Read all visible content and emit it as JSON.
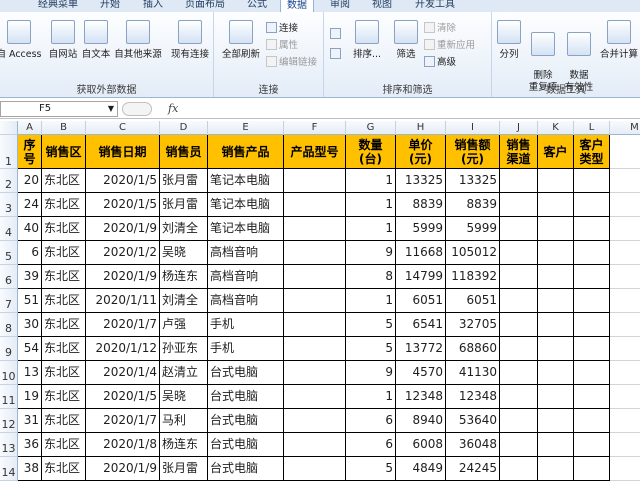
{
  "tabs": [
    {
      "label": "经典菜单",
      "active": false
    },
    {
      "label": "开始",
      "active": false
    },
    {
      "label": "插入",
      "active": false
    },
    {
      "label": "页面布局",
      "active": false
    },
    {
      "label": "公式",
      "active": false
    },
    {
      "label": "数据",
      "active": true
    },
    {
      "label": "审阅",
      "active": false
    },
    {
      "label": "视图",
      "active": false
    },
    {
      "label": "开发工具",
      "active": false
    }
  ],
  "ribbon": {
    "groups": [
      {
        "title": "获取外部数据",
        "buttons": [
          "自 Access",
          "自网站",
          "自文本",
          "自其他来源",
          "现有连接"
        ]
      },
      {
        "title": "连接",
        "buttons": [
          "全部刷新"
        ],
        "small": [
          "连接",
          "属性",
          "编辑链接"
        ]
      },
      {
        "title": "排序和筛选",
        "buttons": [
          "排序...",
          "筛选"
        ],
        "small": [
          "清除",
          "重新应用",
          "高级"
        ]
      },
      {
        "title": "数据工具",
        "buttons": [
          "分列",
          "删除\n重复项",
          "数据\n有效性",
          "合并计算"
        ]
      }
    ]
  },
  "formula_bar": {
    "name_box": "F5",
    "fx": "fx",
    "formula": ""
  },
  "columns": [
    "A",
    "B",
    "C",
    "D",
    "E",
    "F",
    "G",
    "H",
    "I",
    "J",
    "K",
    "L",
    "M"
  ],
  "header_row": [
    "序号",
    "销售区",
    "销售日期",
    "销售员",
    "销售产品",
    "产品型号",
    "数量\n(台)",
    "单价\n(元)",
    "销售额\n(元)",
    "销售\n渠道",
    "客户",
    "客户\n类型"
  ],
  "rows": [
    {
      "n": "2",
      "cells": [
        "20",
        "东北区",
        "2020/1/5",
        "张月雷",
        "笔记本电脑",
        "",
        "1",
        "13325",
        "13325",
        "",
        "",
        ""
      ]
    },
    {
      "n": "3",
      "cells": [
        "24",
        "东北区",
        "2020/1/5",
        "张月雷",
        "笔记本电脑",
        "",
        "1",
        "8839",
        "8839",
        "",
        "",
        ""
      ]
    },
    {
      "n": "4",
      "cells": [
        "40",
        "东北区",
        "2020/1/9",
        "刘清全",
        "笔记本电脑",
        "",
        "1",
        "5999",
        "5999",
        "",
        "",
        ""
      ]
    },
    {
      "n": "5",
      "cells": [
        "6",
        "东北区",
        "2020/1/2",
        "吴晓",
        "高档音响",
        "",
        "9",
        "11668",
        "105012",
        "",
        "",
        ""
      ]
    },
    {
      "n": "6",
      "cells": [
        "39",
        "东北区",
        "2020/1/9",
        "杨连东",
        "高档音响",
        "",
        "8",
        "14799",
        "118392",
        "",
        "",
        ""
      ]
    },
    {
      "n": "7",
      "cells": [
        "51",
        "东北区",
        "2020/1/11",
        "刘清全",
        "高档音响",
        "",
        "1",
        "6051",
        "6051",
        "",
        "",
        ""
      ]
    },
    {
      "n": "8",
      "cells": [
        "30",
        "东北区",
        "2020/1/7",
        "卢强",
        "手机",
        "",
        "5",
        "6541",
        "32705",
        "",
        "",
        ""
      ]
    },
    {
      "n": "9",
      "cells": [
        "54",
        "东北区",
        "2020/1/12",
        "孙亚东",
        "手机",
        "",
        "5",
        "13772",
        "68860",
        "",
        "",
        ""
      ]
    },
    {
      "n": "10",
      "cells": [
        "13",
        "东北区",
        "2020/1/4",
        "赵清立",
        "台式电脑",
        "",
        "9",
        "4570",
        "41130",
        "",
        "",
        ""
      ]
    },
    {
      "n": "11",
      "cells": [
        "19",
        "东北区",
        "2020/1/5",
        "吴晓",
        "台式电脑",
        "",
        "1",
        "12348",
        "12348",
        "",
        "",
        ""
      ]
    },
    {
      "n": "12",
      "cells": [
        "31",
        "东北区",
        "2020/1/7",
        "马利",
        "台式电脑",
        "",
        "6",
        "8940",
        "53640",
        "",
        "",
        ""
      ]
    },
    {
      "n": "13",
      "cells": [
        "36",
        "东北区",
        "2020/1/8",
        "杨连东",
        "台式电脑",
        "",
        "6",
        "6008",
        "36048",
        "",
        "",
        ""
      ]
    },
    {
      "n": "14",
      "cells": [
        "38",
        "东北区",
        "2020/1/9",
        "张月雷",
        "台式电脑",
        "",
        "5",
        "4849",
        "24245",
        "",
        "",
        ""
      ]
    }
  ]
}
